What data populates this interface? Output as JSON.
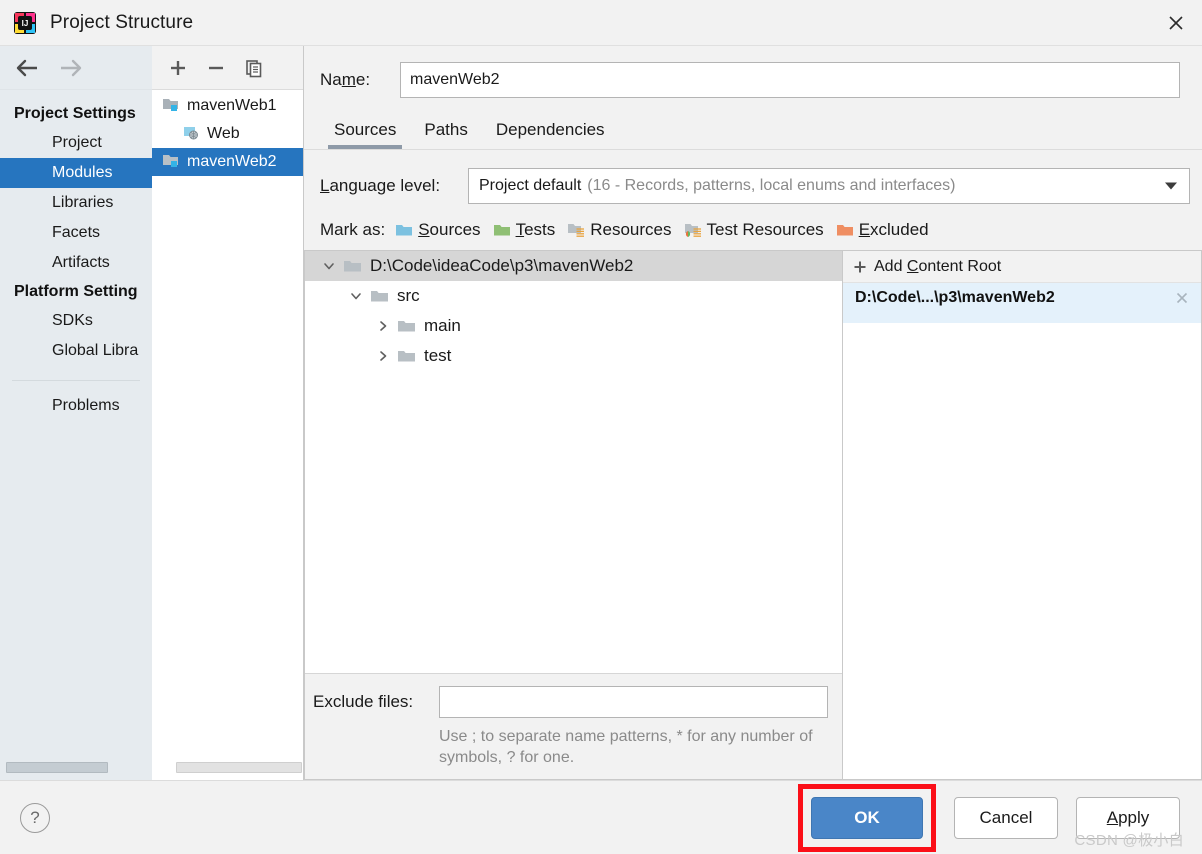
{
  "window": {
    "title": "Project Structure",
    "app_icon": "intellij-idea-icon",
    "close_label": "×"
  },
  "sidebar": {
    "back_icon": "back-arrow-icon",
    "forward_icon": "forward-arrow-icon",
    "groups": [
      {
        "label": "Project Settings",
        "items": [
          {
            "label": "Project",
            "selected": false
          },
          {
            "label": "Modules",
            "selected": true
          },
          {
            "label": "Libraries",
            "selected": false
          },
          {
            "label": "Facets",
            "selected": false
          },
          {
            "label": "Artifacts",
            "selected": false
          }
        ]
      },
      {
        "label": "Platform Setting",
        "items": [
          {
            "label": "SDKs",
            "selected": false
          },
          {
            "label": "Global Libra",
            "selected": false
          }
        ]
      }
    ],
    "problems_label": "Problems"
  },
  "modules_panel": {
    "toolbar": {
      "add_icon": "plus-icon",
      "remove_icon": "minus-icon",
      "copy_icon": "copy-icon"
    },
    "items": [
      {
        "label": "mavenWeb1",
        "icon": "module-folder-icon",
        "indent": false,
        "selected": false
      },
      {
        "label": "Web",
        "icon": "web-facet-icon",
        "indent": true,
        "selected": false
      },
      {
        "label": "mavenWeb2",
        "icon": "module-folder-icon",
        "indent": false,
        "selected": true
      }
    ]
  },
  "main": {
    "name_label": "Name:",
    "name_label_pre": "Na",
    "name_label_mnemonic": "m",
    "name_label_post": "e:",
    "name_value": "mavenWeb2",
    "tabs": [
      {
        "label": "Sources",
        "active": true
      },
      {
        "label": "Paths",
        "active": false
      },
      {
        "label": "Dependencies",
        "active": false
      }
    ],
    "language_level": {
      "label": "Language level:",
      "label_mnemonic": "L",
      "label_rest": "anguage level:",
      "value": "Project default",
      "hint": "(16 - Records, patterns, local enums and interfaces)",
      "caret_icon": "chevron-down-icon"
    },
    "mark_as": {
      "label": "Mark as:",
      "options": [
        {
          "label": "Sources",
          "mnemonic": "S",
          "rest": "ources",
          "color": "#7cc1e0",
          "icon": "folder-sources-icon"
        },
        {
          "label": "Tests",
          "mnemonic": "T",
          "rest": "ests",
          "color": "#8fbf74",
          "icon": "folder-tests-icon"
        },
        {
          "label": "Resources",
          "mnemonic": "",
          "rest": "Resources",
          "color": "#b8bfc4",
          "icon": "folder-resources-icon"
        },
        {
          "label": "Test Resources",
          "mnemonic": "",
          "rest": "Test Resources",
          "color": "#b8bfc4",
          "icon": "folder-test-resources-icon"
        },
        {
          "label": "Excluded",
          "mnemonic": "E",
          "rest": "xcluded",
          "color": "#ef8e62",
          "icon": "folder-excluded-icon"
        }
      ]
    },
    "tree": [
      {
        "label": "D:\\Code\\ideaCode\\p3\\mavenWeb2",
        "depth": 0,
        "expanded": true,
        "selected": true,
        "has_toggle": true
      },
      {
        "label": "src",
        "depth": 1,
        "expanded": true,
        "selected": false,
        "has_toggle": true
      },
      {
        "label": "main",
        "depth": 2,
        "expanded": false,
        "selected": false,
        "has_toggle": true
      },
      {
        "label": "test",
        "depth": 2,
        "expanded": false,
        "selected": false,
        "has_toggle": true
      }
    ],
    "exclude_files": {
      "label": "Exclude files:",
      "value": "",
      "hint": "Use ; to separate name patterns, * for any number of symbols, ? for one."
    },
    "content_roots": {
      "add_label": "Add Content Root",
      "add_label_pre": "Add ",
      "add_label_mnemonic": "C",
      "add_label_post": "ontent Root",
      "add_icon": "plus-icon",
      "items": [
        {
          "label": "D:\\Code\\...\\p3\\mavenWeb2",
          "remove_icon": "close-x-icon"
        }
      ]
    }
  },
  "footer": {
    "help_icon": "question-mark-icon",
    "help_label": "?",
    "buttons": [
      {
        "label": "OK",
        "primary": true,
        "highlighted": true,
        "mnemonic": ""
      },
      {
        "label": "Cancel",
        "primary": false,
        "highlighted": false,
        "mnemonic": ""
      },
      {
        "label": "Apply",
        "primary": false,
        "highlighted": false,
        "mnemonic": "A",
        "rest": "pply"
      }
    ],
    "highlight_color": "#fb0f18"
  },
  "watermark": "CSDN @极小白"
}
